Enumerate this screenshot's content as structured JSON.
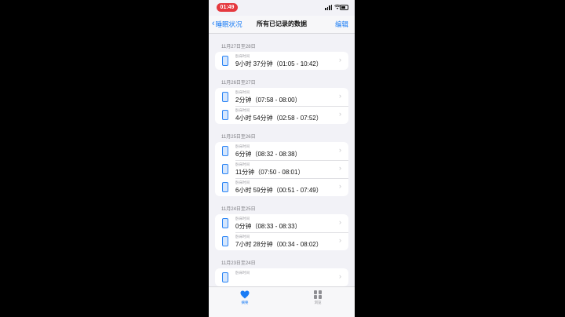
{
  "status": {
    "time": "01:49"
  },
  "nav": {
    "back_label": "睡眠状况",
    "title": "所有已记录的数据",
    "edit_label": "编辑"
  },
  "groups": [
    {
      "header": "11月27日至28日",
      "rows": [
        {
          "label": "卧床时间",
          "value": "9小时 37分钟（01:05 - 10:42）"
        }
      ]
    },
    {
      "header": "11月26日至27日",
      "rows": [
        {
          "label": "卧床时间",
          "value": "2分钟（07:58 - 08:00）"
        },
        {
          "label": "卧床时间",
          "value": "4小时 54分钟（02:58 - 07:52）"
        }
      ]
    },
    {
      "header": "11月25日至26日",
      "rows": [
        {
          "label": "卧床时间",
          "value": "6分钟（08:32 - 08:38）"
        },
        {
          "label": "卧床时间",
          "value": "11分钟（07:50 - 08:01）"
        },
        {
          "label": "卧床时间",
          "value": "6小时 59分钟（00:51 - 07:49）"
        }
      ]
    },
    {
      "header": "11月24日至25日",
      "rows": [
        {
          "label": "卧床时间",
          "value": "0分钟（08:33 - 08:33）"
        },
        {
          "label": "卧床时间",
          "value": "7小时 28分钟（00:34 - 08:02）"
        }
      ]
    },
    {
      "header": "11月23日至24日",
      "rows": [
        {
          "label": "卧床时间",
          "value": ""
        }
      ]
    }
  ],
  "tabs": [
    {
      "label": "摘要",
      "icon": "heart-icon",
      "active": true,
      "color": "#1a7cf5"
    },
    {
      "label": "浏览",
      "icon": "grid-icon",
      "active": false,
      "color": "#8e8e93"
    }
  ]
}
